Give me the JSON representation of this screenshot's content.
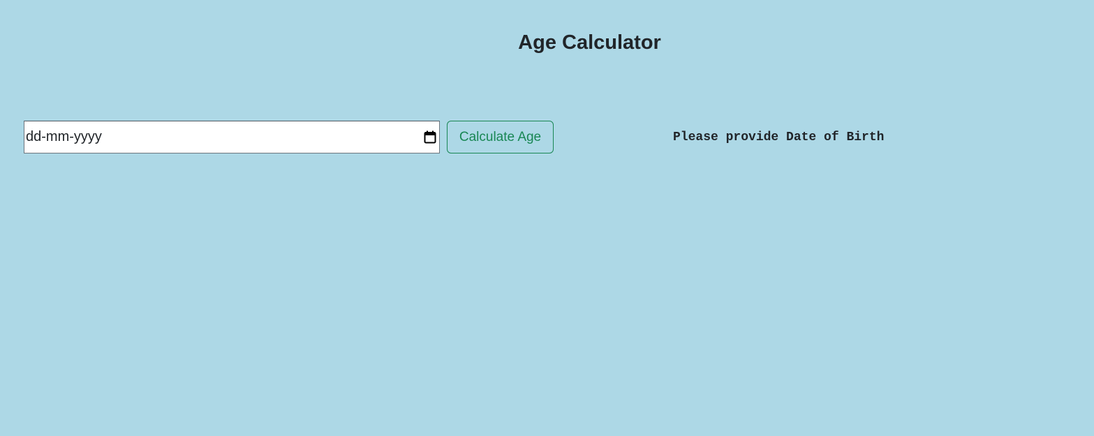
{
  "header": {
    "title": "Age Calculator"
  },
  "form": {
    "date_input": {
      "placeholder": "dd-mm-yyyy",
      "value": "",
      "icon": "calendar-icon"
    },
    "calculate_button_label": "Calculate Age"
  },
  "result": {
    "message": "Please provide Date of Birth"
  },
  "colors": {
    "background": "#add8e6",
    "button_accent": "#198754",
    "text": "#212529"
  }
}
